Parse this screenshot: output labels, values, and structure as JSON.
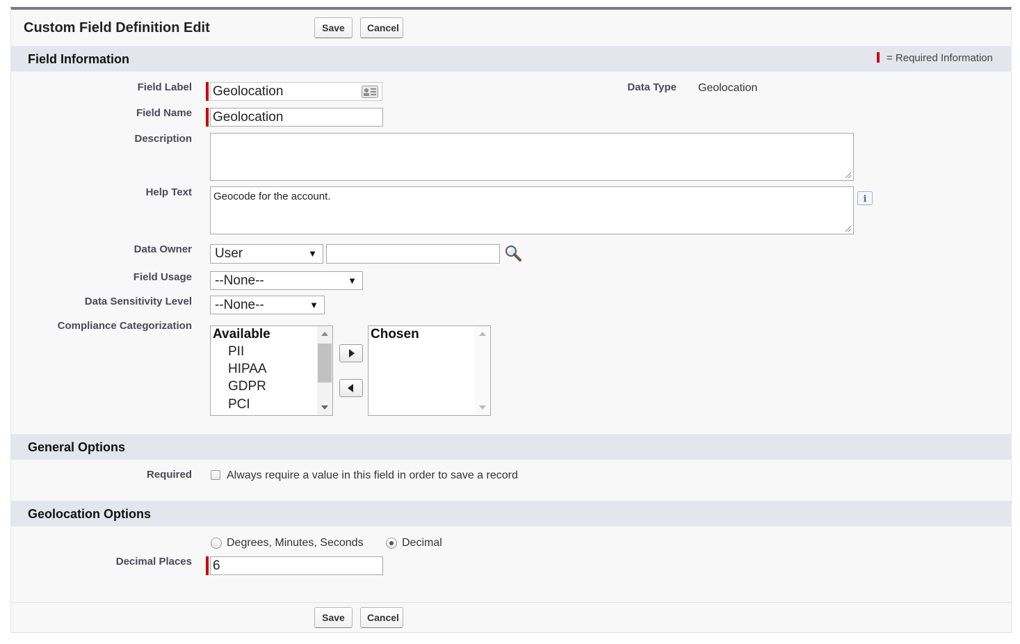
{
  "page": {
    "title": "Custom Field Definition Edit"
  },
  "buttons": {
    "save": "Save",
    "cancel": "Cancel"
  },
  "sections": {
    "field_information": "Field Information",
    "general_options": "General Options",
    "geolocation_options": "Geolocation Options"
  },
  "required_legend": "= Required Information",
  "fields": {
    "field_label": {
      "label": "Field Label",
      "value": "Geolocation"
    },
    "field_name": {
      "label": "Field Name",
      "value": "Geolocation"
    },
    "description": {
      "label": "Description",
      "value": ""
    },
    "help_text": {
      "label": "Help Text",
      "value": "Geocode for the account."
    },
    "data_type": {
      "label": "Data Type",
      "value": "Geolocation"
    },
    "data_owner": {
      "label": "Data Owner",
      "type_value": "User",
      "value": ""
    },
    "field_usage": {
      "label": "Field Usage",
      "value": "--None--"
    },
    "data_sensitivity": {
      "label": "Data Sensitivity Level",
      "value": "--None--"
    },
    "compliance": {
      "label": "Compliance Categorization",
      "available_header": "Available",
      "available": [
        "PII",
        "HIPAA",
        "GDPR",
        "PCI"
      ],
      "chosen_header": "Chosen",
      "chosen": []
    },
    "required": {
      "label": "Required",
      "text": "Always require a value in this field in order to save a record",
      "checked": false
    },
    "location_format": {
      "options": [
        "Degrees, Minutes, Seconds",
        "Decimal"
      ],
      "selected": "Decimal"
    },
    "decimal_places": {
      "label": "Decimal Places",
      "value": "6"
    }
  },
  "colors": {
    "required": "#cc0000",
    "section_bg": "#e3e6ec",
    "page_bg": "#f8f8f8",
    "header_border": "#747e86"
  },
  "icons": {
    "lookup": "magnifier-lookup-icon",
    "info": "info-icon",
    "card": "contact-card-icon"
  }
}
